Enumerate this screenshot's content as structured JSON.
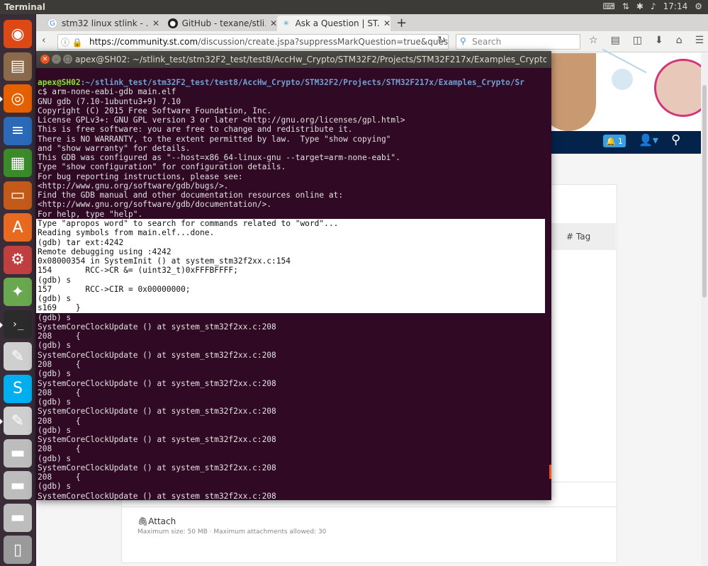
{
  "system": {
    "app_title": "Terminal",
    "time": "17:14",
    "tray_icons": [
      "keyboard-icon",
      "network-icon",
      "bluetooth-icon",
      "volume-icon",
      "gear-icon"
    ]
  },
  "launcher": {
    "items": [
      {
        "name": "ubuntu-dash-icon",
        "color": "#dd4814",
        "glyph": "◉"
      },
      {
        "name": "files-icon",
        "color": "#8a6a4a",
        "glyph": "▤"
      },
      {
        "name": "firefox-icon",
        "color": "#e66000",
        "glyph": "◎"
      },
      {
        "name": "writer-icon",
        "color": "#2a6ab8",
        "glyph": "≡"
      },
      {
        "name": "calc-icon",
        "color": "#3a8a2a",
        "glyph": "▦"
      },
      {
        "name": "impress-icon",
        "color": "#c45a1a",
        "glyph": "▭"
      },
      {
        "name": "software-center-icon",
        "color": "#e86a20",
        "glyph": "A"
      },
      {
        "name": "system-settings-icon",
        "color": "#c04040",
        "glyph": "⚙"
      },
      {
        "name": "android-studio-icon",
        "color": "#6aa84f",
        "glyph": "✦"
      },
      {
        "name": "terminal-icon",
        "color": "#2b2b2b",
        "glyph": "›_"
      },
      {
        "name": "text-editor-icon",
        "color": "#cfcfcf",
        "glyph": "✎"
      },
      {
        "name": "skype-icon",
        "color": "#00aff0",
        "glyph": "S"
      },
      {
        "name": "text-editor-2-icon",
        "color": "#cfcfcf",
        "glyph": "✎"
      },
      {
        "name": "drive-icon",
        "color": "#bdbdbd",
        "glyph": "▬"
      },
      {
        "name": "drive-2-icon",
        "color": "#bdbdbd",
        "glyph": "▬"
      },
      {
        "name": "drive-3-icon",
        "color": "#bdbdbd",
        "glyph": "▬"
      },
      {
        "name": "trash-icon",
        "color": "#9a9a9a",
        "glyph": "▯"
      }
    ]
  },
  "browser": {
    "tabs": [
      {
        "label": "stm32 linux stlink - ...",
        "icon": "google-icon"
      },
      {
        "label": "GitHub - texane/stli...",
        "icon": "github-icon"
      },
      {
        "label": "Ask a Question | ST...",
        "icon": "st-icon"
      }
    ],
    "url_host": "https://community.st.com",
    "url_path": "/discussion/create.jspa?suppressMarkQuestion=true&quest",
    "search_placeholder": "Search",
    "notif_count": "1",
    "tag_label": "# Tag",
    "tag_prefix": "n",
    "attach_label": "Attach",
    "attach_info": "Maximum size: 50 MB  ·  Maximum attachments allowed: 30"
  },
  "terminal": {
    "title": "apex@SH02: ~/stlink_test/stm32F2_test/test8/AccHw_Crypto/STM32F2/Projects/STM32F217x/Examples_Crypto/Src",
    "prompt_user": "apex@SH02",
    "prompt_path": ":~/stlink_test/stm32F2_test/test8/AccHw_Crypto/STM32F2/Projects/STM32F217x/Examples_Crypto/Sr",
    "lines": [
      "c$ arm-none-eabi-gdb main.elf",
      "GNU gdb (7.10-1ubuntu3+9) 7.10",
      "Copyright (C) 2015 Free Software Foundation, Inc.",
      "License GPLv3+: GNU GPL version 3 or later <http://gnu.org/licenses/gpl.html>",
      "This is free software: you are free to change and redistribute it.",
      "There is NO WARRANTY, to the extent permitted by law.  Type \"show copying\"",
      "and \"show warranty\" for details.",
      "This GDB was configured as \"--host=x86_64-linux-gnu --target=arm-none-eabi\".",
      "Type \"show configuration\" for configuration details.",
      "For bug reporting instructions, please see:",
      "<http://www.gnu.org/software/gdb/bugs/>.",
      "Find the GDB manual and other documentation resources online at:",
      "<http://www.gnu.org/software/gdb/documentation/>.",
      "For help, type \"help\".",
      "Type \"apropos word\" to search for commands related to \"word\"...",
      "Reading symbols from main.elf...done.",
      "(gdb) tar ext:4242",
      "Remote debugging using :4242",
      "0x08000354 in SystemInit () at system_stm32f2xx.c:154",
      "154       RCC->CR &= (uint32_t)0xFFFBFFFF;",
      "(gdb) s",
      "157       RCC->CIR = 0x00000000;",
      "(gdb) s",
      "s169    }",
      "(gdb) s",
      "SystemCoreClockUpdate () at system_stm32f2xx.c:208",
      "208     {",
      "(gdb) s",
      "SystemCoreClockUpdate () at system_stm32f2xx.c:208",
      "208     {",
      "(gdb) s",
      "SystemCoreClockUpdate () at system_stm32f2xx.c:208",
      "208     {",
      "(gdb) s",
      "SystemCoreClockUpdate () at system_stm32f2xx.c:208",
      "208     {",
      "(gdb) s",
      "SystemCoreClockUpdate () at system_stm32f2xx.c:208",
      "208     {",
      "(gdb) s",
      "SystemCoreClockUpdate () at system_stm32f2xx.c:208",
      "208     {",
      "(gdb) s",
      "SystemCoreClockUpdate () at system_stm32f2xx.c:208"
    ],
    "highlight_start": 14,
    "highlight_end": 23
  }
}
